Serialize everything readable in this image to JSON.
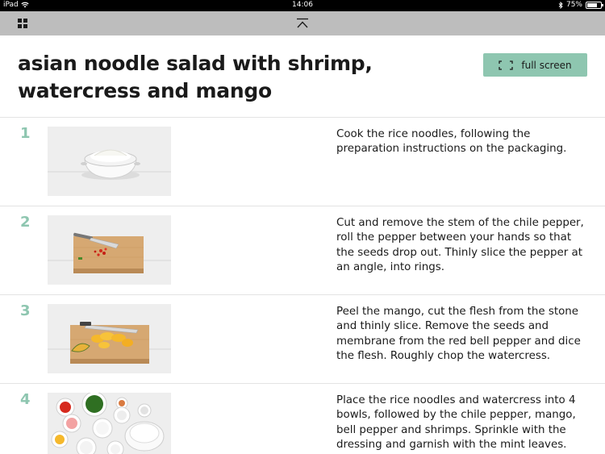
{
  "status_bar": {
    "device": "iPad",
    "time": "14:06",
    "battery": "75%",
    "battery_level": 0.75
  },
  "toolbar": {
    "menu_icon": "grid-icon",
    "collapse_icon": "collapse-up-icon"
  },
  "recipe": {
    "title": "asian noodle salad with shrimp, watercress and mango",
    "fullscreen_label": "full screen"
  },
  "colors": {
    "accent": "#8ec6b0",
    "toolbar": "#bdbdbd",
    "text": "#1a1a1a"
  },
  "steps": [
    {
      "number": "1",
      "text": "Cook the rice noodles, following the preparation instructions on the packaging."
    },
    {
      "number": "2",
      "text": "Cut and remove the stem of the chile pepper, roll the pepper between your hands so that the seeds drop out. Thinly slice the pepper at an angle, into rings."
    },
    {
      "number": "3",
      "text": "Peel the mango, cut the flesh from the stone and thinly slice. Remove the seeds and membrane from the red bell pepper and dice the flesh. Roughly chop the watercress."
    },
    {
      "number": "4",
      "text": "Place the rice noodles and watercress into 4 bowls, followed by the chile pepper, mango, bell pepper and shrimps. Sprinkle with the dressing and garnish with the mint leaves."
    }
  ]
}
